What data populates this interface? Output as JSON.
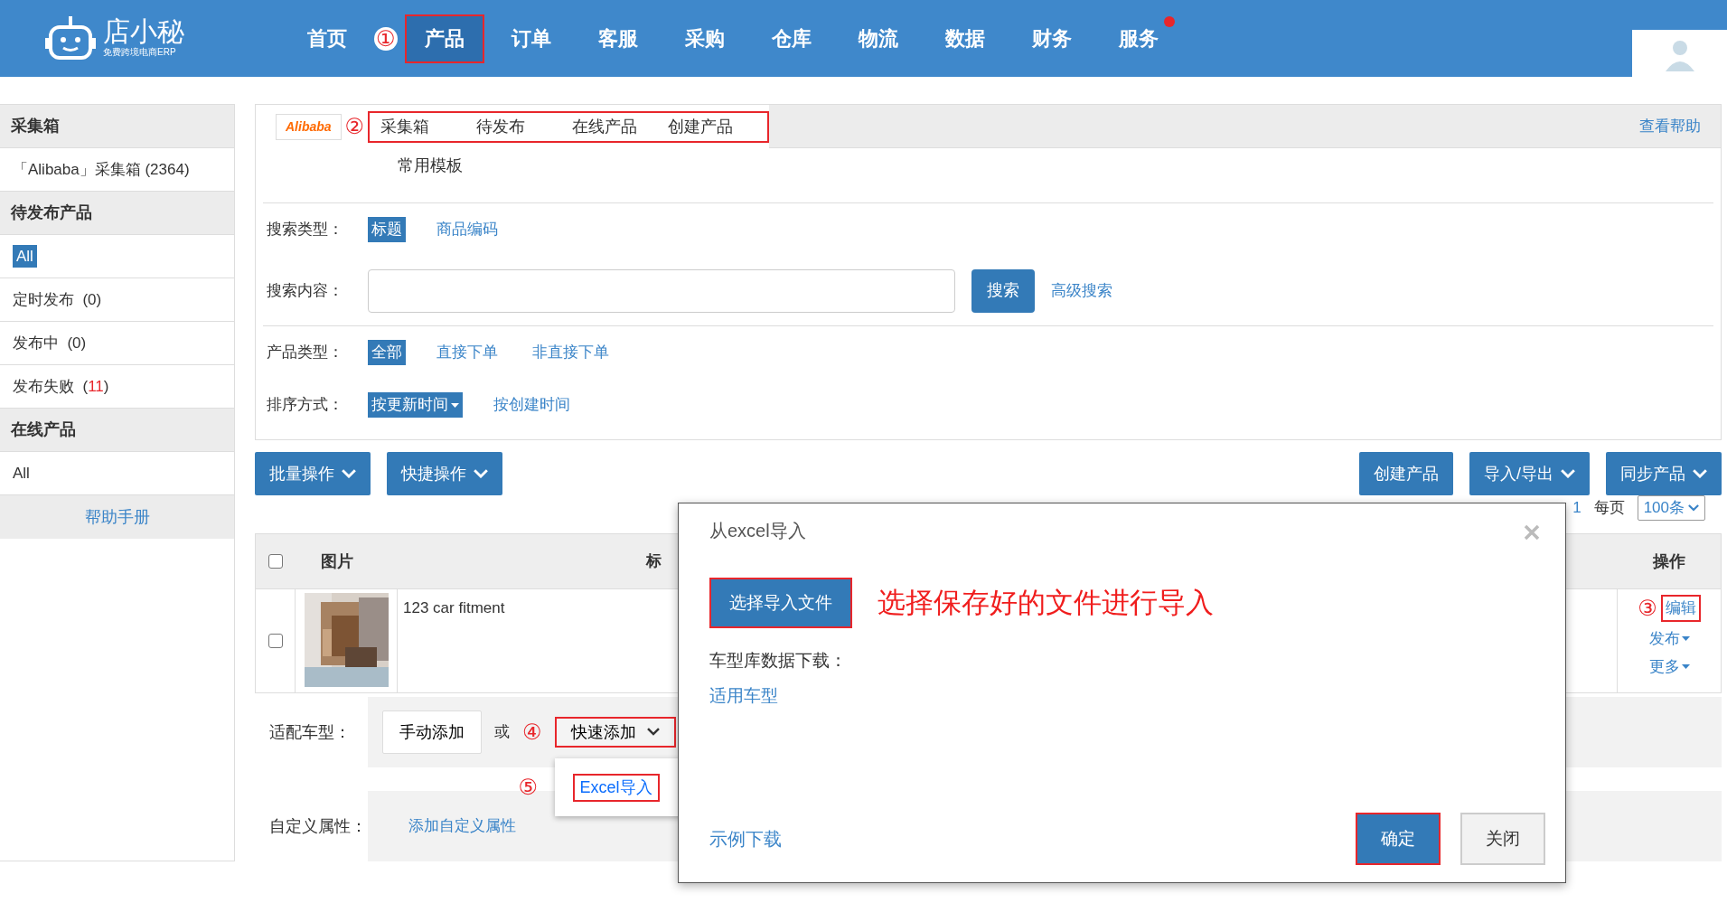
{
  "header": {
    "logo": {
      "title": "店小秘",
      "subtitle": "免费跨境电商ERP"
    },
    "nav": [
      {
        "label": "首页",
        "selected": false,
        "highlighted": false,
        "notification": false
      },
      {
        "label": "产品",
        "selected": true,
        "highlighted": true,
        "marker": "①",
        "notification": false
      },
      {
        "label": "订单",
        "selected": false,
        "highlighted": false,
        "notification": false
      },
      {
        "label": "客服",
        "selected": false,
        "highlighted": false,
        "notification": false
      },
      {
        "label": "采购",
        "selected": false,
        "highlighted": false,
        "notification": false
      },
      {
        "label": "仓库",
        "selected": false,
        "highlighted": false,
        "notification": false
      },
      {
        "label": "物流",
        "selected": false,
        "highlighted": false,
        "notification": false
      },
      {
        "label": "数据",
        "selected": false,
        "highlighted": false,
        "notification": false
      },
      {
        "label": "财务",
        "selected": false,
        "highlighted": false,
        "notification": false
      },
      {
        "label": "服务",
        "selected": false,
        "highlighted": false,
        "notification": true
      }
    ]
  },
  "sidebar": {
    "sections": [
      {
        "title": "采集箱",
        "items": [
          {
            "label": "「Alibaba」采集箱 (2364)",
            "selected": false
          }
        ]
      },
      {
        "title": "待发布产品",
        "items": [
          {
            "label": "All",
            "selected": true
          },
          {
            "label": "定时发布",
            "count": "(0)",
            "alert": false,
            "selected": false
          },
          {
            "label": "发布中",
            "count": "(0)",
            "alert": false,
            "selected": false
          },
          {
            "label": "发布失败",
            "count": "(11)",
            "alert": true,
            "selected": false
          }
        ]
      },
      {
        "title": "在线产品",
        "items": [
          {
            "label": "All",
            "selected": false
          }
        ]
      }
    ],
    "footer_link": "帮助手册"
  },
  "panel": {
    "platform_logo": "Alibaba",
    "tabs_marker": "②",
    "tabs_highlighted": true,
    "tabs": [
      {
        "label": "采集箱"
      },
      {
        "label": "待发布"
      },
      {
        "label": "在线产品"
      },
      {
        "label": "创建产品"
      }
    ],
    "tabs_row2": [
      {
        "label": "常用模板"
      }
    ],
    "help_link": "查看帮助",
    "filters": [
      {
        "kind": "options",
        "label": "搜索类型：",
        "options": [
          {
            "label": "标题",
            "selected": true
          },
          {
            "label": "商品编码",
            "selected": false
          }
        ]
      },
      {
        "kind": "search",
        "label": "搜索内容：",
        "button": "搜索",
        "link": "高级搜索"
      },
      {
        "kind": "options",
        "label": "产品类型：",
        "options": [
          {
            "label": "全部",
            "selected": true
          },
          {
            "label": "直接下单",
            "selected": false
          },
          {
            "label": "非直接下单",
            "selected": false
          }
        ]
      },
      {
        "kind": "options",
        "label": "排序方式：",
        "options": [
          {
            "label": "按更新时间",
            "selected": true,
            "caret": true
          },
          {
            "label": "按创建时间",
            "selected": false
          }
        ]
      }
    ]
  },
  "toolbar": {
    "left": [
      {
        "label": "批量操作",
        "caret": true
      },
      {
        "label": "快捷操作",
        "caret": true
      }
    ],
    "right": [
      {
        "label": "创建产品",
        "caret": false
      },
      {
        "label": "导入/导出",
        "caret": true
      },
      {
        "label": "同步产品",
        "caret": true
      }
    ]
  },
  "pagination": {
    "page": "1",
    "per_page_label": "每页",
    "per_page": "100条"
  },
  "table": {
    "header_checked": false,
    "columns": [
      "图片",
      "标",
      "操作"
    ],
    "rows": [
      {
        "selected": false,
        "image": {
          "kind": "picture"
        },
        "title": "123 car fitment",
        "actions": [
          {
            "label": "编辑",
            "highlighted": true,
            "marker": "③",
            "caret": false
          },
          {
            "label": "发布",
            "highlighted": false,
            "caret": true
          },
          {
            "label": "更多",
            "highlighted": false,
            "caret": true
          }
        ]
      }
    ]
  },
  "product_form": [
    {
      "kind": "vehicle",
      "label": "适配车型：",
      "manual_button": "手动添加",
      "or_text": "或",
      "quick_add": {
        "label": "快速添加",
        "highlighted": true,
        "marker": "④",
        "expanded": true,
        "menu": [
          {
            "label": "Excel导入",
            "highlighted": true,
            "marker": "⑤"
          }
        ]
      }
    },
    {
      "kind": "custom",
      "label": "自定义属性：",
      "link": "添加自定义属性"
    }
  ],
  "modal": {
    "title": "从excel导入",
    "file_button": {
      "label": "选择导入文件",
      "highlighted": true
    },
    "note": "选择保存好的文件进行导入",
    "download_label": "车型库数据下载：",
    "download_link": "适用车型",
    "sample_link": "示例下载",
    "buttons": [
      {
        "label": "确定",
        "kind": "primary",
        "highlighted": true
      },
      {
        "label": "关闭",
        "kind": "secondary",
        "highlighted": false
      }
    ]
  }
}
